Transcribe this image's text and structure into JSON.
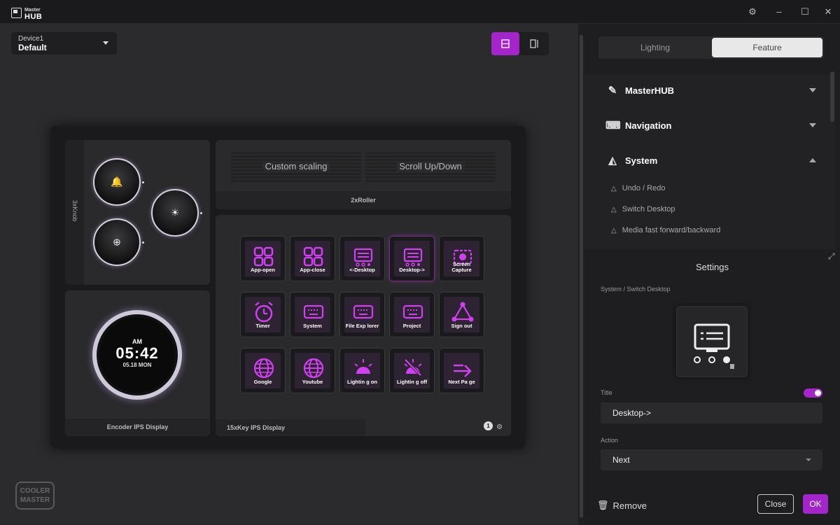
{
  "app": {
    "logo_top": "Master",
    "logo_bottom": "HUB"
  },
  "window_controls": [
    "settings-icon",
    "minimize-icon",
    "maximize-icon",
    "close-icon"
  ],
  "device": {
    "label": "Device1",
    "value": "Default"
  },
  "layout": {
    "knob_label": "3xKnob",
    "roller_label": "2xRoller",
    "roller_left": "Custom scaling",
    "roller_right": "Scroll Up/Down",
    "encoder_label": "Encoder IPS Display",
    "keys_label": "15xKey IPS Display",
    "page_number": "1"
  },
  "clock": {
    "ampm": "AM",
    "time": "05:42",
    "date": "05.18 MON"
  },
  "keys": [
    {
      "label": "App-open",
      "icon": "grid-icon"
    },
    {
      "label": "App-close",
      "icon": "grid-icon"
    },
    {
      "label": "<-Desktop",
      "icon": "monitor-icon"
    },
    {
      "label": "Desktop->",
      "icon": "monitor-icon",
      "selected": true
    },
    {
      "label": "Screen Capture",
      "icon": "camera-icon"
    },
    {
      "label": "Timer",
      "icon": "alarm-icon"
    },
    {
      "label": "System",
      "icon": "keyboard-icon"
    },
    {
      "label": "File Exp lorer",
      "icon": "keyboard-icon"
    },
    {
      "label": "Project",
      "icon": "keyboard-icon"
    },
    {
      "label": "Sign out",
      "icon": "triangle-icon"
    },
    {
      "label": "Google",
      "icon": "globe-icon"
    },
    {
      "label": "Youtube",
      "icon": "globe-icon"
    },
    {
      "label": "Lightin g on",
      "icon": "sun-icon"
    },
    {
      "label": "Lightin g off",
      "icon": "sun-off-icon"
    },
    {
      "label": "Next Pa ge",
      "icon": "arrow-icon"
    }
  ],
  "brand": {
    "line1": "COOLER",
    "line2": "MASTER"
  },
  "right": {
    "tabs": [
      "Lighting",
      "Feature"
    ],
    "categories": [
      {
        "label": "MasterHUB",
        "icon": "masterhub-icon"
      },
      {
        "label": "Navigation",
        "icon": "keyboard-icon"
      },
      {
        "label": "System",
        "icon": "system-icon"
      }
    ],
    "sub_items": [
      "Undo / Redo",
      "Switch Desktop",
      "Media fast forward/backward"
    ],
    "settings_title": "Settings",
    "path": "System / Switch Desktop",
    "title_label": "Title",
    "title_value": "Desktop->",
    "action_label": "Action",
    "action_value": "Next",
    "remove_label": "Remove",
    "close_label": "Close",
    "ok_label": "OK"
  },
  "colors": {
    "accent": "#a425c9",
    "key_face": "#2e2333"
  }
}
